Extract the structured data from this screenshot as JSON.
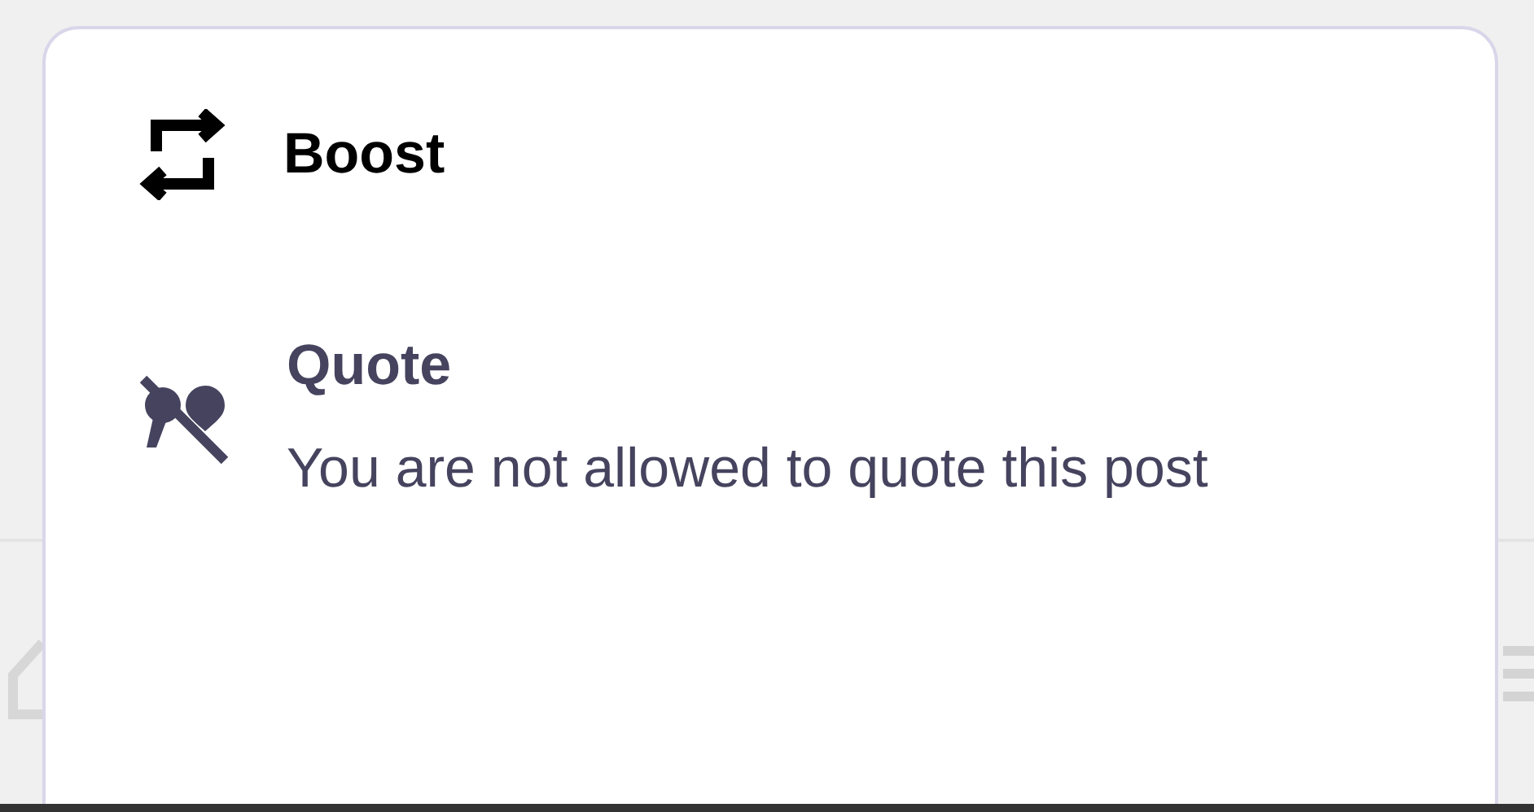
{
  "menu": {
    "items": [
      {
        "kind": "boost",
        "label": "Boost",
        "disabled": false
      },
      {
        "kind": "quote",
        "label": "Quote",
        "description": "You are not allowed to quote this post",
        "disabled": true
      }
    ]
  }
}
